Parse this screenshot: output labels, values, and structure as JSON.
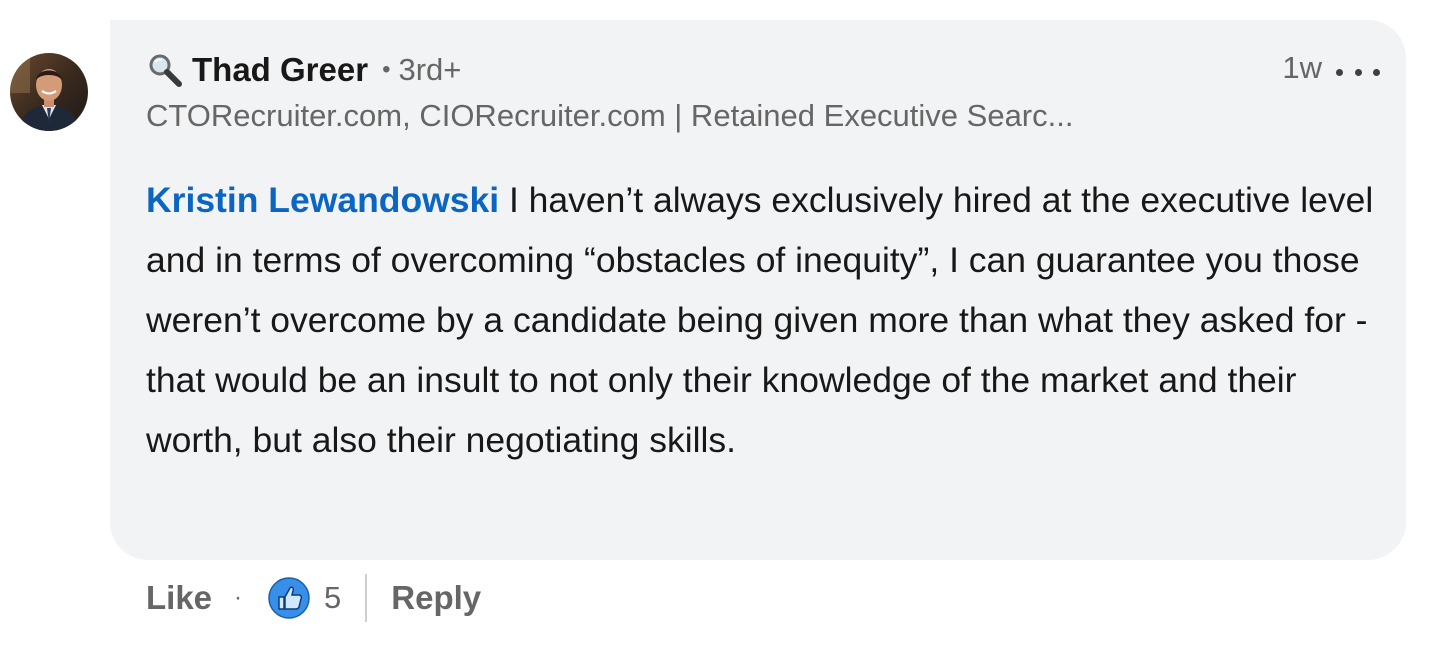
{
  "author": {
    "name": "Thad Greer",
    "degree": "3rd+",
    "separator": "•",
    "headline": "CTORecruiter.com, CIORecruiter.com | Retained Executive Searc...",
    "avatar_icon": "profile-photo"
  },
  "meta": {
    "timestamp": "1w",
    "more_icon": "more-horizontal-icon"
  },
  "comment": {
    "mention": "Kristin Lewandowski",
    "text": " I haven’t always exclusively hired at the executive level and in terms of overcoming “obstacles of inequity”, I can guarantee you those weren’t overcome by a candidate being given more than what they asked for - that would be an insult to not only their knowledge of the market and their worth, but also their negotiating skills."
  },
  "actions": {
    "like_label": "Like",
    "separator": "·",
    "reaction_icon": "thumbs-up-icon",
    "reaction_count": "5",
    "reply_label": "Reply"
  },
  "colors": {
    "bubble_bg": "#f2f3f5",
    "mention": "#0a66c2",
    "secondary_text": "#666666",
    "like_reaction": "#378fe9"
  }
}
